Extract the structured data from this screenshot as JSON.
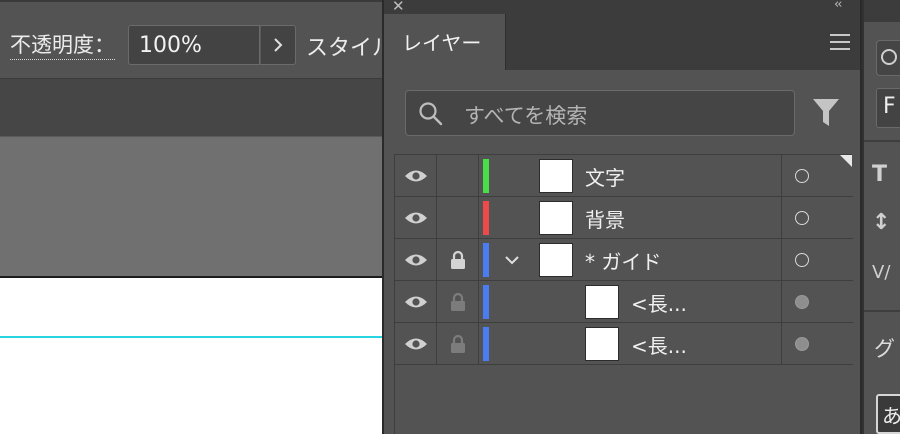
{
  "toolbar": {
    "opacity_label": "不透明度：",
    "opacity_value": "100%",
    "style_label": "スタイル"
  },
  "layers_panel": {
    "tab_label": "レイヤー",
    "search_placeholder": "すべてを検索",
    "layers": [
      {
        "name": "文字",
        "color": "#48e048",
        "visible": true,
        "locked": false,
        "expandable": false,
        "indent": 0,
        "target_filled": false
      },
      {
        "name": "背景",
        "color": "#ef4a4a",
        "visible": true,
        "locked": false,
        "expandable": false,
        "indent": 0,
        "target_filled": false
      },
      {
        "name": "* ガイド",
        "color": "#4a7ef0",
        "visible": true,
        "locked": true,
        "expandable": true,
        "indent": 0,
        "target_filled": false
      },
      {
        "name": "<長...",
        "color": "#4a7ef0",
        "visible": true,
        "locked": true,
        "expandable": false,
        "indent": 1,
        "target_filled": true
      },
      {
        "name": "<長...",
        "color": "#4a7ef0",
        "visible": true,
        "locked": true,
        "expandable": false,
        "indent": 1,
        "target_filled": true
      }
    ]
  },
  "right_panel": {
    "field_text": "F",
    "label": "グ",
    "bottom_char": "あ"
  },
  "colors": {
    "panel_bg": "#535353",
    "guide_line": "#27d6e0"
  }
}
